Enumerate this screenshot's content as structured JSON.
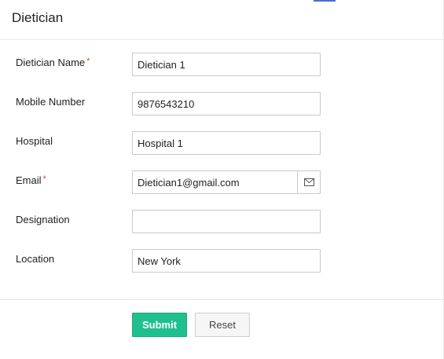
{
  "header": {
    "title": "Dietician"
  },
  "form": {
    "fields": [
      {
        "label": "Dietician Name",
        "required": true,
        "value": "Dietician 1"
      },
      {
        "label": "Mobile Number",
        "required": false,
        "value": "9876543210"
      },
      {
        "label": "Hospital",
        "required": false,
        "value": "Hospital 1"
      },
      {
        "label": "Email",
        "required": true,
        "value": "Dietician1@gmail.com",
        "addon_icon": "envelope-icon"
      },
      {
        "label": "Designation",
        "required": false,
        "value": ""
      },
      {
        "label": "Location",
        "required": false,
        "value": "New York"
      }
    ],
    "required_marker": "*"
  },
  "actions": {
    "submit_label": "Submit",
    "reset_label": "Reset"
  },
  "colors": {
    "accent": "#4a6fd1",
    "submit": "#20c08e",
    "required": "#e0443c"
  }
}
